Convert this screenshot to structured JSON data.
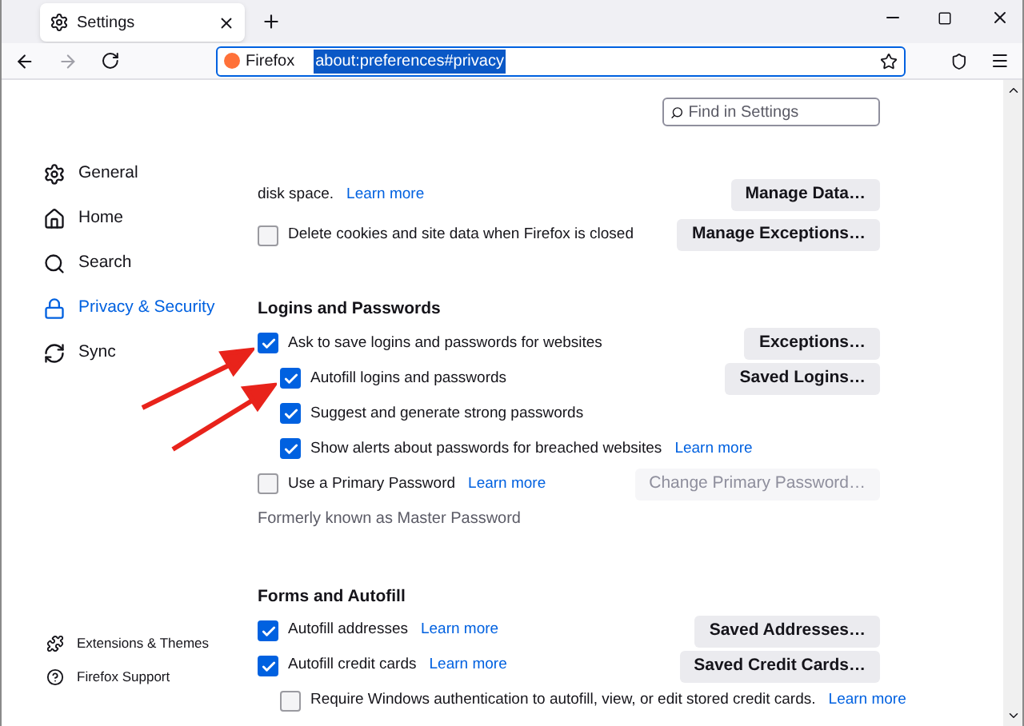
{
  "browser": {
    "tab_title": "Settings",
    "identity": "Firefox",
    "url": "about:preferences#privacy"
  },
  "search": {
    "placeholder": "Find in Settings"
  },
  "sidebar": {
    "items": [
      {
        "kind": "gear",
        "label": "General",
        "selected": false
      },
      {
        "kind": "home",
        "label": "Home",
        "selected": false
      },
      {
        "kind": "search",
        "label": "Search",
        "selected": false
      },
      {
        "kind": "lock",
        "label": "Privacy & Security",
        "selected": true
      },
      {
        "kind": "sync",
        "label": "Sync",
        "selected": false
      }
    ],
    "footer": [
      {
        "kind": "puzzle",
        "label": "Extensions & Themes"
      },
      {
        "kind": "help",
        "label": "Firefox Support"
      }
    ]
  },
  "sections": [
    {
      "rows": [
        {
          "kind": "text",
          "label": "disk space.",
          "link": "Learn more",
          "button": {
            "label": "Manage Data…",
            "disabled": false
          }
        },
        {
          "kind": "checkbox",
          "label": "Delete cookies and site data when Firefox is closed",
          "checked": false,
          "button": {
            "label": "Manage Exceptions…",
            "disabled": false
          }
        }
      ]
    },
    {
      "heading": "Logins and Passwords",
      "rows": [
        {
          "kind": "checkbox",
          "label": "Ask to save logins and passwords for websites",
          "checked": true,
          "button": {
            "label": "Exceptions…",
            "disabled": false
          },
          "children": [
            {
              "kind": "checkbox",
              "label": "Autofill logins and passwords",
              "checked": true,
              "button": {
                "label": "Saved Logins…",
                "disabled": false
              }
            },
            {
              "kind": "checkbox",
              "label": "Suggest and generate strong passwords",
              "checked": true
            },
            {
              "kind": "checkbox",
              "label": "Show alerts about passwords for breached websites",
              "checked": true,
              "link": "Learn more"
            }
          ]
        },
        {
          "kind": "checkbox",
          "label": "Use a Primary Password",
          "checked": false,
          "link": "Learn more",
          "button": {
            "label": "Change Primary Password…",
            "disabled": true
          }
        },
        {
          "kind": "note",
          "label": "Formerly known as Master Password"
        }
      ]
    },
    {
      "heading": "Forms and Autofill",
      "rows": [
        {
          "kind": "checkbox",
          "label": "Autofill addresses",
          "checked": true,
          "link": "Learn more",
          "button": {
            "label": "Saved Addresses…",
            "disabled": false
          }
        },
        {
          "kind": "checkbox",
          "label": "Autofill credit cards",
          "checked": true,
          "link": "Learn more",
          "button": {
            "label": "Saved Credit Cards…",
            "disabled": false
          },
          "children": [
            {
              "kind": "checkbox",
              "label": "Require Windows authentication to autofill, view, or edit stored credit cards.",
              "checked": false,
              "link": "Learn more"
            }
          ]
        }
      ]
    }
  ]
}
